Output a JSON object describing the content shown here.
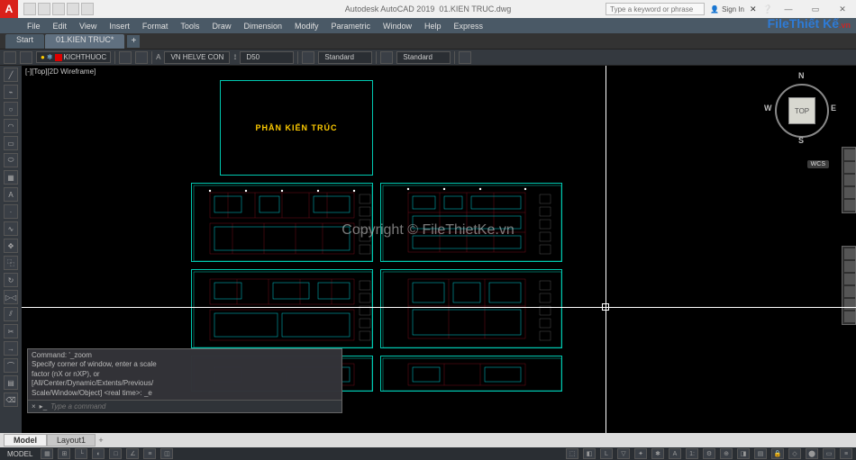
{
  "app": {
    "name": "Autodesk AutoCAD 2019",
    "filename": "01.KIEN TRUC.dwg",
    "search_placeholder": "Type a keyword or phrase",
    "signin": "Sign In"
  },
  "menus": [
    "File",
    "Edit",
    "View",
    "Insert",
    "Format",
    "Tools",
    "Draw",
    "Dimension",
    "Modify",
    "Parametric",
    "Window",
    "Help",
    "Express"
  ],
  "tabs": {
    "start": "Start",
    "active": "01.KIEN TRUC*"
  },
  "layer": {
    "current": "KICHTHUOC"
  },
  "styles": {
    "textstyle": "VN HELVE CON",
    "dimstyle": "D50",
    "tablestyle1": "Standard",
    "tablestyle2": "Standard"
  },
  "viewport": {
    "label": "[-][Top][2D Wireframe]"
  },
  "viewcube": {
    "face": "TOP",
    "n": "N",
    "s": "S",
    "e": "E",
    "w": "W",
    "wcs": "WCS"
  },
  "drawing": {
    "title_text": "PHẦN KIẾN TRÚC"
  },
  "command": {
    "history": [
      "Command: '_zoom",
      "Specify corner of window, enter a scale",
      "factor (nX or nXP), or",
      "[All/Center/Dynamic/Extents/Previous/",
      "Scale/Window/Object] <real time>: _e"
    ],
    "prompt_placeholder": "Type a command"
  },
  "layout_tabs": {
    "model": "Model",
    "layout1": "Layout1"
  },
  "status": {
    "space": "MODEL"
  },
  "watermark": {
    "center": "Copyright © FileThietKe.vn",
    "logo1": "File",
    "logo2": "Thiết Kế",
    "logo3": ".vn"
  }
}
